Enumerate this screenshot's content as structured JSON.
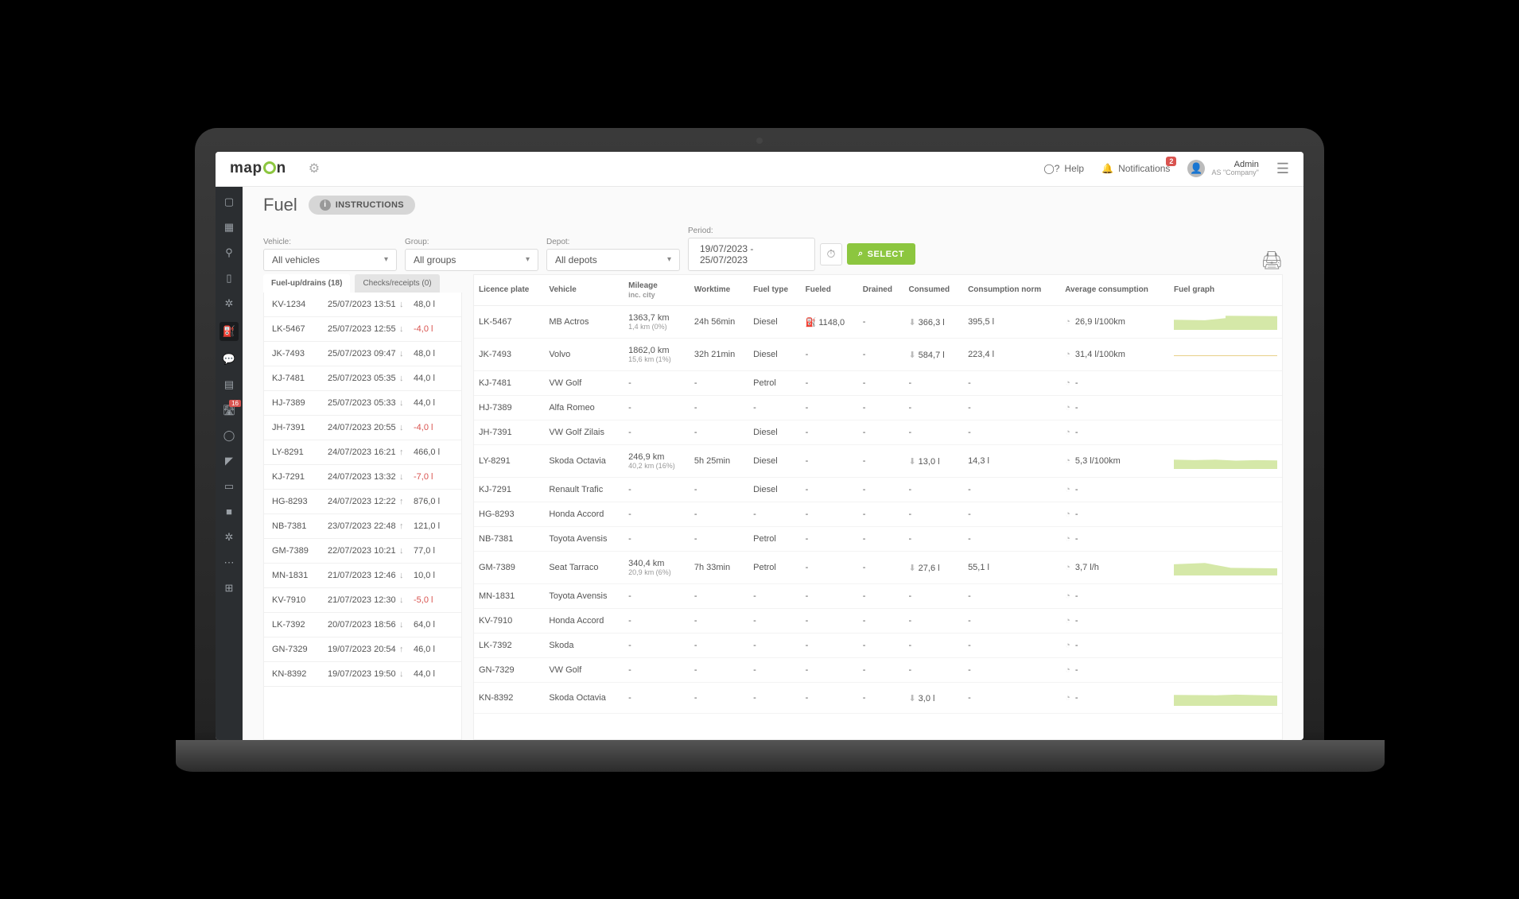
{
  "brand": {
    "name": "mapOn"
  },
  "topbar": {
    "help": "Help",
    "notifications": "Notifications",
    "notification_count": "2",
    "user": {
      "name": "Admin",
      "company": "AS \"Company\""
    }
  },
  "leftnav_badge": "16",
  "page": {
    "title": "Fuel",
    "instructions": "INSTRUCTIONS"
  },
  "filters": {
    "vehicle_label": "Vehicle:",
    "vehicle_value": "All vehicles",
    "group_label": "Group:",
    "group_value": "All groups",
    "depot_label": "Depot:",
    "depot_value": "All depots",
    "period_label": "Period:",
    "period_value": "19/07/2023 - 25/07/2023",
    "select_btn": "SELECT"
  },
  "tabs": {
    "fuelup": "Fuel-up/drains (18)",
    "checks": "Checks/receipts (0)"
  },
  "events": [
    {
      "plate": "KV-1234",
      "date": "25/07/2023 13:51",
      "icon": "↓",
      "val": "48,0 l",
      "neg": false
    },
    {
      "plate": "LK-5467",
      "date": "25/07/2023 12:55",
      "icon": "↓",
      "val": "-4,0 l",
      "neg": true
    },
    {
      "plate": "JK-7493",
      "date": "25/07/2023 09:47",
      "icon": "↓",
      "val": "48,0 l",
      "neg": false
    },
    {
      "plate": "KJ-7481",
      "date": "25/07/2023 05:35",
      "icon": "↓",
      "val": "44,0 l",
      "neg": false
    },
    {
      "plate": "HJ-7389",
      "date": "25/07/2023 05:33",
      "icon": "↓",
      "val": "44,0 l",
      "neg": false
    },
    {
      "plate": "JH-7391",
      "date": "24/07/2023 20:55",
      "icon": "↓",
      "val": "-4,0 l",
      "neg": true
    },
    {
      "plate": "LY-8291",
      "date": "24/07/2023 16:21",
      "icon": "↑",
      "val": "466,0 l",
      "neg": false
    },
    {
      "plate": "KJ-7291",
      "date": "24/07/2023 13:32",
      "icon": "↓",
      "val": "-7,0 l",
      "neg": true
    },
    {
      "plate": "HG-8293",
      "date": "24/07/2023 12:22",
      "icon": "↑",
      "val": "876,0 l",
      "neg": false
    },
    {
      "plate": "NB-7381",
      "date": "23/07/2023 22:48",
      "icon": "↑",
      "val": "121,0 l",
      "neg": false
    },
    {
      "plate": "GM-7389",
      "date": "22/07/2023 10:21",
      "icon": "↓",
      "val": "77,0 l",
      "neg": false
    },
    {
      "plate": "MN-1831",
      "date": "21/07/2023 12:46",
      "icon": "↓",
      "val": "10,0 l",
      "neg": false
    },
    {
      "plate": "KV-7910",
      "date": "21/07/2023 12:30",
      "icon": "↓",
      "val": "-5,0 l",
      "neg": true
    },
    {
      "plate": "LK-7392",
      "date": "20/07/2023 18:56",
      "icon": "↓",
      "val": "64,0 l",
      "neg": false
    },
    {
      "plate": "GN-7329",
      "date": "19/07/2023 20:54",
      "icon": "↑",
      "val": "46,0 l",
      "neg": false
    },
    {
      "plate": "KN-8392",
      "date": "19/07/2023 19:50",
      "icon": "↓",
      "val": "44,0 l",
      "neg": false
    }
  ],
  "table": {
    "headers": {
      "licence": "Licence plate",
      "vehicle": "Vehicle",
      "mileage": "Mileage",
      "mileage_sub": "inc. city",
      "worktime": "Worktime",
      "fueltype": "Fuel type",
      "fueled": "Fueled",
      "drained": "Drained",
      "consumed": "Consumed",
      "norm": "Consumption norm",
      "avg": "Average consumption",
      "graph": "Fuel graph"
    },
    "rows": [
      {
        "plate": "LK-5467",
        "veh": "MB Actros",
        "mil": "1363,7 km",
        "mil2": "1,4 km (0%)",
        "wt": "24h 56min",
        "ft": "Diesel",
        "fu": "1148,0",
        "dr": "-",
        "co": "366,3 l",
        "no": "395,5 l",
        "av": "26,9 l/100km",
        "g": "g1"
      },
      {
        "plate": "JK-7493",
        "veh": "Volvo",
        "mil": "1862,0 km",
        "mil2": "15,6 km (1%)",
        "wt": "32h 21min",
        "ft": "Diesel",
        "fu": "-",
        "dr": "-",
        "co": "584,7 l",
        "no": "223,4 l",
        "av": "31,4 l/100km",
        "g": "line"
      },
      {
        "plate": "KJ-7481",
        "veh": "VW Golf",
        "mil": "-",
        "mil2": "",
        "wt": "-",
        "ft": "Petrol",
        "fu": "-",
        "dr": "-",
        "co": "-",
        "no": "-",
        "av": "-",
        "g": ""
      },
      {
        "plate": "HJ-7389",
        "veh": "Alfa Romeo",
        "mil": "-",
        "mil2": "",
        "wt": "-",
        "ft": "-",
        "fu": "-",
        "dr": "-",
        "co": "-",
        "no": "-",
        "av": "-",
        "g": ""
      },
      {
        "plate": "JH-7391",
        "veh": "VW Golf Zilais",
        "mil": "-",
        "mil2": "",
        "wt": "-",
        "ft": "Diesel",
        "fu": "-",
        "dr": "-",
        "co": "-",
        "no": "-",
        "av": "-",
        "g": ""
      },
      {
        "plate": "LY-8291",
        "veh": "Skoda Octavia",
        "mil": "246,9 km",
        "mil2": "40,2 km (16%)",
        "wt": "5h 25min",
        "ft": "Diesel",
        "fu": "-",
        "dr": "-",
        "co": "13,0 l",
        "no": "14,3 l",
        "av": "5,3 l/100km",
        "g": "g3"
      },
      {
        "plate": "KJ-7291",
        "veh": "Renault Trafic",
        "mil": "-",
        "mil2": "",
        "wt": "-",
        "ft": "Diesel",
        "fu": "-",
        "dr": "-",
        "co": "-",
        "no": "-",
        "av": "-",
        "g": ""
      },
      {
        "plate": "HG-8293",
        "veh": "Honda Accord",
        "mil": "-",
        "mil2": "",
        "wt": "-",
        "ft": "-",
        "fu": "-",
        "dr": "-",
        "co": "-",
        "no": "-",
        "av": "-",
        "g": ""
      },
      {
        "plate": "NB-7381",
        "veh": "Toyota Avensis",
        "mil": "-",
        "mil2": "",
        "wt": "-",
        "ft": "Petrol",
        "fu": "-",
        "dr": "-",
        "co": "-",
        "no": "-",
        "av": "-",
        "g": ""
      },
      {
        "plate": "GM-7389",
        "veh": "Seat Tarraco",
        "mil": "340,4 km",
        "mil2": "20,9 km (6%)",
        "wt": "7h 33min",
        "ft": "Petrol",
        "fu": "-",
        "dr": "-",
        "co": "27,6 l",
        "no": "55,1 l",
        "av": "3,7 l/h",
        "g": "g4"
      },
      {
        "plate": "MN-1831",
        "veh": "Toyota Avensis",
        "mil": "-",
        "mil2": "",
        "wt": "-",
        "ft": "-",
        "fu": "-",
        "dr": "-",
        "co": "-",
        "no": "-",
        "av": "-",
        "g": ""
      },
      {
        "plate": "KV-7910",
        "veh": "Honda Accord",
        "mil": "-",
        "mil2": "",
        "wt": "-",
        "ft": "-",
        "fu": "-",
        "dr": "-",
        "co": "-",
        "no": "-",
        "av": "-",
        "g": ""
      },
      {
        "plate": "LK-7392",
        "veh": "Skoda",
        "mil": "-",
        "mil2": "",
        "wt": "-",
        "ft": "-",
        "fu": "-",
        "dr": "-",
        "co": "-",
        "no": "-",
        "av": "-",
        "g": ""
      },
      {
        "plate": "GN-7329",
        "veh": "VW Golf",
        "mil": "-",
        "mil2": "",
        "wt": "-",
        "ft": "-",
        "fu": "-",
        "dr": "-",
        "co": "-",
        "no": "-",
        "av": "-",
        "g": ""
      },
      {
        "plate": "KN-8392",
        "veh": "Skoda Octavia",
        "mil": "-",
        "mil2": "",
        "wt": "-",
        "ft": "-",
        "fu": "-",
        "dr": "-",
        "co": "3,0 l",
        "no": "-",
        "av": "-",
        "g": "g5"
      }
    ]
  }
}
